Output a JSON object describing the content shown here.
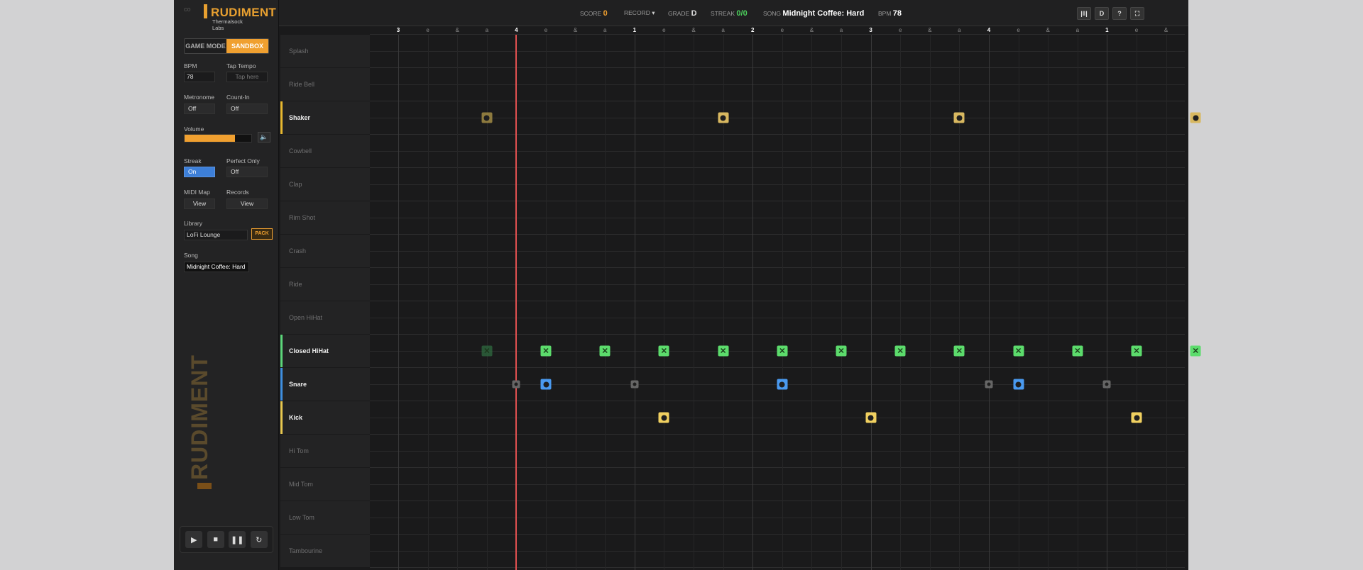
{
  "app": {
    "brand": "RUDIMENT",
    "company": "Thermalsock Labs",
    "brand_color": "#e8a030"
  },
  "sidebar": {
    "mode_game": "GAME MODE",
    "mode_sandbox": "SANDBOX",
    "bpm_label": "BPM",
    "bpm_value": "78",
    "tap_label": "Tap Tempo",
    "tap_placeholder": "Tap here",
    "metronome_label": "Metronome",
    "metronome_value": "Off",
    "countin_label": "Count-In",
    "countin_value": "Off",
    "volume_label": "Volume",
    "volume_level": 0.75,
    "streak_label": "Streak",
    "streak_value": "On",
    "perfect_label": "Perfect Only",
    "perfect_value": "Off",
    "midi_label": "MIDI Map",
    "midi_button": "View",
    "records_label": "Records",
    "records_button": "View",
    "library_label": "Library",
    "library_value": "LoFi Lounge",
    "pack_button": "PACK",
    "song_label": "Song",
    "song_value": "Midnight Coffee: Hard",
    "vertical_logo": "RUDIMENT",
    "transport": [
      "play-icon",
      "stop-icon",
      "pause-icon",
      "loop-icon"
    ]
  },
  "topbar": {
    "score_label": "SCORE",
    "score_value": "0",
    "record_label": "RECORD",
    "grade_label": "GRADE",
    "grade_value": "D",
    "streak_label": "STREAK",
    "streak_value": "0/0",
    "song_label": "SONG",
    "song_value": "Midnight Coffee: Hard",
    "bpm_label": "BPM",
    "bpm_value": "78",
    "icons": [
      "levels-icon",
      "D",
      "?",
      "fullscreen-icon"
    ]
  },
  "ruler": [
    "3",
    "e",
    "&",
    "a",
    "4",
    "e",
    "&",
    "a",
    "1",
    "e",
    "&",
    "a",
    "2",
    "e",
    "&",
    "a",
    "3",
    "e",
    "&",
    "a",
    "4",
    "e",
    "&",
    "a",
    "1",
    "e",
    "&"
  ],
  "tracks": [
    {
      "name": "Splash",
      "active": false,
      "color": ""
    },
    {
      "name": "Ride Bell",
      "active": false,
      "color": ""
    },
    {
      "name": "Shaker",
      "active": true,
      "color": "#e8b830"
    },
    {
      "name": "Cowbell",
      "active": false,
      "color": ""
    },
    {
      "name": "Clap",
      "active": false,
      "color": ""
    },
    {
      "name": "Rim Shot",
      "active": false,
      "color": ""
    },
    {
      "name": "Crash",
      "active": false,
      "color": ""
    },
    {
      "name": "Ride",
      "active": false,
      "color": ""
    },
    {
      "name": "Open HiHat",
      "active": false,
      "color": ""
    },
    {
      "name": "Closed HiHat",
      "active": true,
      "color": "#5cd67a"
    },
    {
      "name": "Snare",
      "active": true,
      "color": "#3f8fe0"
    },
    {
      "name": "Kick",
      "active": true,
      "color": "#e8c850"
    },
    {
      "name": "Hi Tom",
      "active": false,
      "color": ""
    },
    {
      "name": "Mid Tom",
      "active": false,
      "color": ""
    },
    {
      "name": "Low Tom",
      "active": false,
      "color": ""
    },
    {
      "name": "Tambourine",
      "active": false,
      "color": ""
    }
  ],
  "playhead_step": 4,
  "notes": [
    {
      "track": 2,
      "step": 3,
      "kind": "circ",
      "color": "#b49a4a",
      "dim": true
    },
    {
      "track": 2,
      "step": 11,
      "kind": "circ",
      "color": "#d8b860"
    },
    {
      "track": 2,
      "step": 19,
      "kind": "circ",
      "color": "#d8b860"
    },
    {
      "track": 2,
      "step": 27,
      "kind": "circ",
      "color": "#d8b860"
    },
    {
      "track": 9,
      "step": 3,
      "kind": "x",
      "color": "#2f6b3f",
      "dim": true
    },
    {
      "track": 9,
      "step": 5,
      "kind": "x",
      "color": "#5cdc6c"
    },
    {
      "track": 9,
      "step": 7,
      "kind": "x",
      "color": "#5cdc6c"
    },
    {
      "track": 9,
      "step": 9,
      "kind": "x",
      "color": "#5cdc6c"
    },
    {
      "track": 9,
      "step": 11,
      "kind": "x",
      "color": "#5cdc6c"
    },
    {
      "track": 9,
      "step": 13,
      "kind": "x",
      "color": "#5cdc6c"
    },
    {
      "track": 9,
      "step": 15,
      "kind": "x",
      "color": "#5cdc6c"
    },
    {
      "track": 9,
      "step": 17,
      "kind": "x",
      "color": "#5cdc6c"
    },
    {
      "track": 9,
      "step": 19,
      "kind": "x",
      "color": "#5cdc6c"
    },
    {
      "track": 9,
      "step": 21,
      "kind": "x",
      "color": "#5cdc6c"
    },
    {
      "track": 9,
      "step": 23,
      "kind": "x",
      "color": "#5cdc6c"
    },
    {
      "track": 9,
      "step": 25,
      "kind": "x",
      "color": "#5cdc6c"
    },
    {
      "track": 9,
      "step": 27,
      "kind": "x",
      "color": "#5cdc6c"
    },
    {
      "track": 10,
      "step": 4,
      "kind": "circ",
      "color": "#666666",
      "small": true
    },
    {
      "track": 10,
      "step": 5,
      "kind": "circ",
      "color": "#4a9af0"
    },
    {
      "track": 10,
      "step": 8,
      "kind": "circ",
      "color": "#666666",
      "small": true
    },
    {
      "track": 10,
      "step": 13,
      "kind": "circ",
      "color": "#4a9af0"
    },
    {
      "track": 10,
      "step": 20,
      "kind": "circ",
      "color": "#666666",
      "small": true
    },
    {
      "track": 10,
      "step": 21,
      "kind": "circ",
      "color": "#4a9af0"
    },
    {
      "track": 10,
      "step": 24,
      "kind": "circ",
      "color": "#666666",
      "small": true
    },
    {
      "track": 11,
      "step": 9,
      "kind": "circ",
      "color": "#f0d060"
    },
    {
      "track": 11,
      "step": 16,
      "kind": "circ",
      "color": "#f0d060"
    },
    {
      "track": 11,
      "step": 25,
      "kind": "circ",
      "color": "#f0d060"
    }
  ]
}
